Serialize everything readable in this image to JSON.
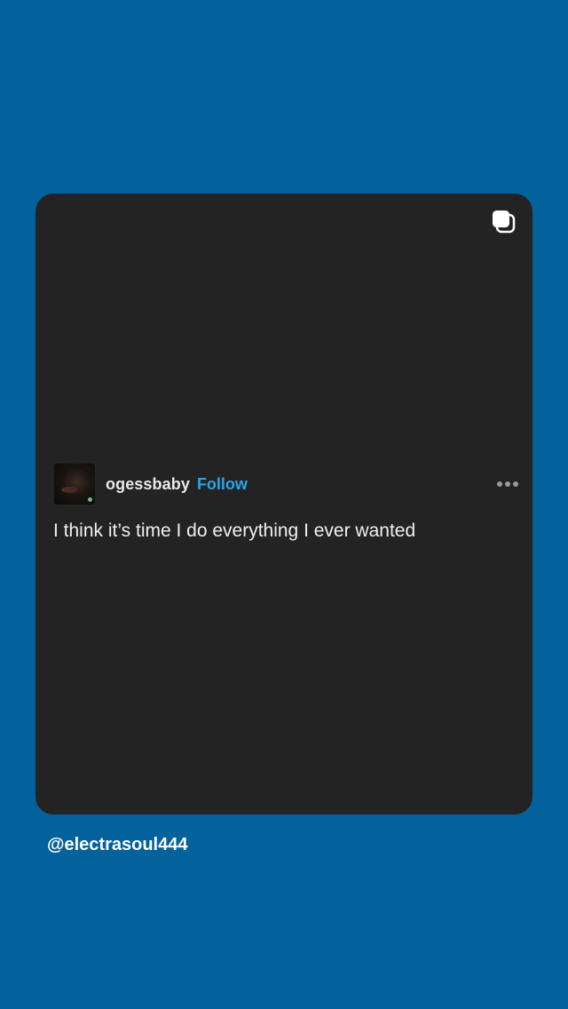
{
  "post": {
    "username": "ogessbaby",
    "follow_label": "Follow",
    "text": "I think it’s time I do everything I ever wanted",
    "more_icon": "more-horizontal-icon",
    "stack_icon": "multiple-posts-icon"
  },
  "credit": {
    "handle": "@electrasoul444"
  },
  "colors": {
    "background": "#03619c",
    "card": "#232323",
    "follow": "#2aa5e8"
  }
}
